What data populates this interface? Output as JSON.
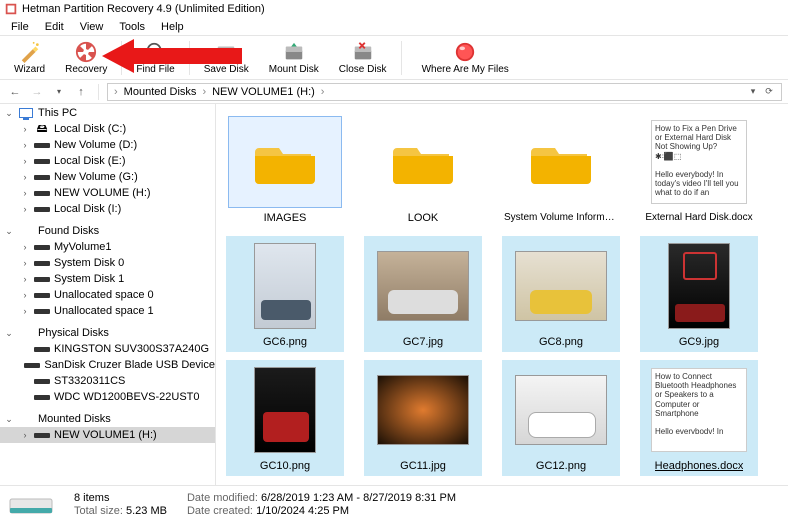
{
  "app": {
    "title": "Hetman Partition Recovery 4.9 (Unlimited Edition)"
  },
  "menu": [
    "File",
    "Edit",
    "View",
    "Tools",
    "Help"
  ],
  "toolbar": {
    "wizard": "Wizard",
    "recovery": "Recovery",
    "findfile": "Find File",
    "savedisk": "Save Disk",
    "mountdisk": "Mount Disk",
    "closedisk": "Close Disk",
    "wherefiles": "Where Are My Files"
  },
  "breadcrumb": {
    "seg1": "Mounted Disks",
    "seg2": "NEW VOLUME1 (H:)"
  },
  "tree": {
    "thispc": {
      "label": "This PC",
      "children": [
        {
          "label": "Local Disk (C:)"
        },
        {
          "label": "New Volume (D:)"
        },
        {
          "label": "Local Disk (E:)"
        },
        {
          "label": "New Volume (G:)"
        },
        {
          "label": "NEW VOLUME (H:)"
        },
        {
          "label": "Local Disk (I:)"
        }
      ]
    },
    "found": {
      "label": "Found Disks",
      "children": [
        {
          "label": "MyVolume1"
        },
        {
          "label": "System Disk 0"
        },
        {
          "label": "System Disk 1"
        },
        {
          "label": "Unallocated space 0"
        },
        {
          "label": "Unallocated space 1"
        }
      ]
    },
    "physical": {
      "label": "Physical Disks",
      "children": [
        {
          "label": "KINGSTON SUV300S37A240G"
        },
        {
          "label": "SanDisk Cruzer Blade USB Device"
        },
        {
          "label": "ST3320311CS"
        },
        {
          "label": "WDC WD1200BEVS-22UST0"
        }
      ]
    },
    "mounted": {
      "label": "Mounted Disks",
      "children": [
        {
          "label": "NEW VOLUME1 (H:)"
        }
      ]
    }
  },
  "folders": [
    {
      "name": "IMAGES"
    },
    {
      "name": "LOOK"
    },
    {
      "name": "System Volume Information"
    }
  ],
  "docs": [
    {
      "name": "External Hard Disk.docx",
      "preview": "How to Fix a Pen Drive or External Hard Disk Not Showing Up? ✱꞉⬛⬚\n\nHello everybody! In today's video I'll tell you what to do if an"
    }
  ],
  "images_row1": [
    {
      "name": "GC6.png",
      "style": "car-white-tall"
    },
    {
      "name": "GC7.jpg",
      "style": "car-silver"
    },
    {
      "name": "GC8.png",
      "style": "car-yellow"
    },
    {
      "name": "GC9.jpg",
      "style": "car-red-66-tall"
    }
  ],
  "docs2": {
    "name": "Headphones.docx",
    "preview": "How to Connect Bluetooth Headphones or Speakers to a Computer or Smartphone\n\nHello evervbodv! In"
  },
  "images_row2": [
    {
      "name": "GC10.png",
      "style": "car-red-tall"
    },
    {
      "name": "GC11.jpg",
      "style": "car-night"
    },
    {
      "name": "GC12.png",
      "style": "car-white"
    }
  ],
  "status": {
    "items": "8 items",
    "totalsize_label": "Total size:",
    "totalsize_val": "5.23 MB",
    "modified_label": "Date modified:",
    "modified_val": "6/28/2019 1:23 AM - 8/27/2019 8:31 PM",
    "created_label": "Date created:",
    "created_val": "1/10/2024 4:25 PM"
  }
}
